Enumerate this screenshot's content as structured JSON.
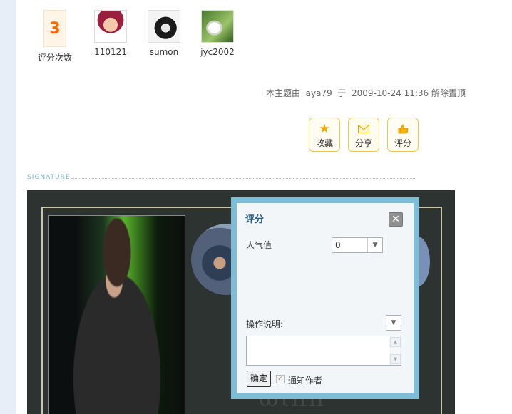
{
  "rating": {
    "count": "3",
    "count_label": "评分次数",
    "users": [
      "110121",
      "sumon",
      "jyc2002"
    ]
  },
  "topic_info": {
    "prefix": "本主题由",
    "user": "aya79",
    "middle": "于",
    "datetime": "2009-10-24 11:36",
    "action": "解除置顶"
  },
  "actions": {
    "favorite": "收藏",
    "share": "分享",
    "rate": "评分"
  },
  "signature": {
    "label": "SIGNATURE",
    "watermark": "ωιππ"
  },
  "dialog": {
    "title": "评分",
    "close": "✕",
    "popularity_label": "人气值",
    "popularity_value": "0",
    "note_label": "操作说明:",
    "note_value": "",
    "ok_label": "确定",
    "notify_label": "通知作者",
    "notify_checked": true
  },
  "icons": {
    "favorite": "star-icon",
    "share": "envelope-icon",
    "rate": "thumb-icon"
  }
}
